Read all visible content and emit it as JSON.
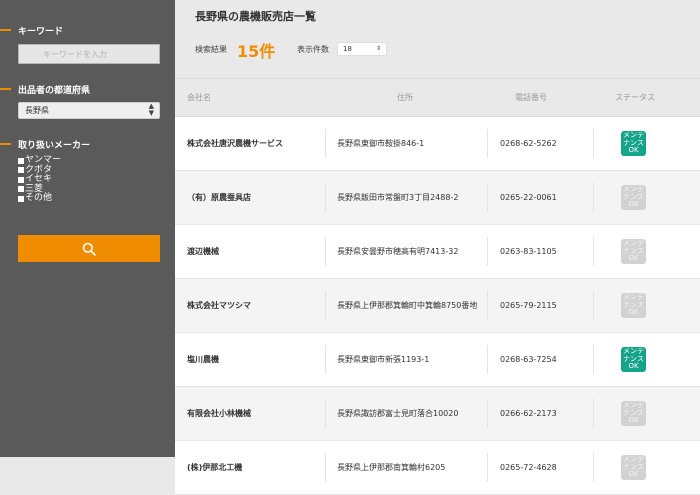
{
  "sidebar": {
    "keyword_title": "キーワード",
    "keyword_placeholder": "キーワードを入力",
    "pref_title": "出品者の都道府県",
    "pref_selected": "長野県",
    "maker_title": "取り扱いメーカー",
    "makers": [
      "ヤンマー",
      "クボタ",
      "イセキ",
      "三菱",
      "その他"
    ],
    "search_icon": "search-icon",
    "accent_color": "#f08c00"
  },
  "main": {
    "title": "長野県の農機販売店一覧",
    "result_label": "検索結果",
    "result_count": "15件",
    "display_label": "表示件数",
    "display_value": "18"
  },
  "table": {
    "headers": {
      "company": "会社名",
      "address": "住所",
      "phone": "電話番号",
      "status": "ステータス"
    },
    "rows": [
      {
        "company": "株式会社唐沢農機サービス",
        "address": "長野県東御市鞍掛846-1",
        "phone": "0268-62-5262",
        "status": "メンテナンスOK",
        "active": true
      },
      {
        "company": "（有）原農蚕具店",
        "address": "長野県飯田市常盤町3丁目2488-2",
        "phone": "0265-22-0061",
        "status": "メンテナンスOK",
        "active": false
      },
      {
        "company": "渡辺機械",
        "address": "長野県安曇野市穂高有明7413-32",
        "phone": "0263-83-1105",
        "status": "メンテナンスOK",
        "active": false
      },
      {
        "company": "株式会社マツシマ",
        "address": "長野県上伊那郡箕輪町中箕輪8750番地",
        "phone": "0265-79-2115",
        "status": "メンテナンスOK",
        "active": false
      },
      {
        "company": "塩川農機",
        "address": "長野県東御市新張1193-1",
        "phone": "0268-63-7254",
        "status": "メンテナンスOK",
        "active": true
      },
      {
        "company": "有限会社小林機械",
        "address": "長野県諏訪郡富士見町落合10020",
        "phone": "0266-62-2173",
        "status": "メンテナンスOK",
        "active": false
      },
      {
        "company": "(株)伊那北工機",
        "address": "長野県上伊那郡南箕輪村6205",
        "phone": "0265-72-4628",
        "status": "メンテナンスOK",
        "active": false
      }
    ],
    "status_colors": {
      "active": "#15a38a",
      "inactive": "#d2d2d2"
    }
  }
}
